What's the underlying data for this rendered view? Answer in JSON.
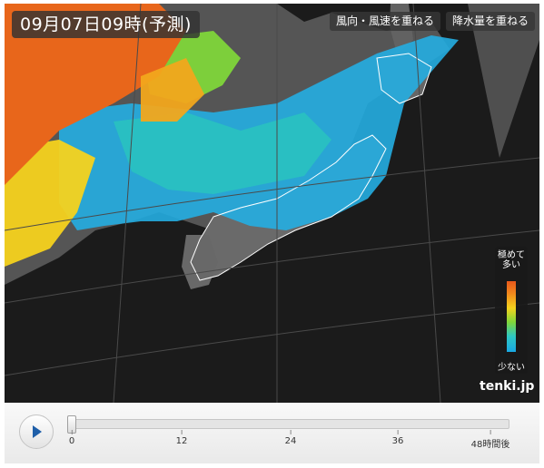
{
  "map": {
    "time_label": "09月07日09時(予測)",
    "wind_button_label": "風向・風速を重ねる",
    "precip_button_label": "降水量を重ねる",
    "legend": {
      "top_label": "極めて\n多い",
      "bottom_label": "少ない",
      "colors": [
        "#e8581b",
        "#f28a1c",
        "#f5d21d",
        "#7fd63a",
        "#2ec7c3",
        "#19a8e3"
      ]
    },
    "brand": "tenki.jp"
  },
  "timeline": {
    "play_icon": "play-icon",
    "current_hour": 0,
    "max_hour": 48,
    "ticks": [
      "0",
      "12",
      "24",
      "36",
      "48時間後"
    ]
  }
}
